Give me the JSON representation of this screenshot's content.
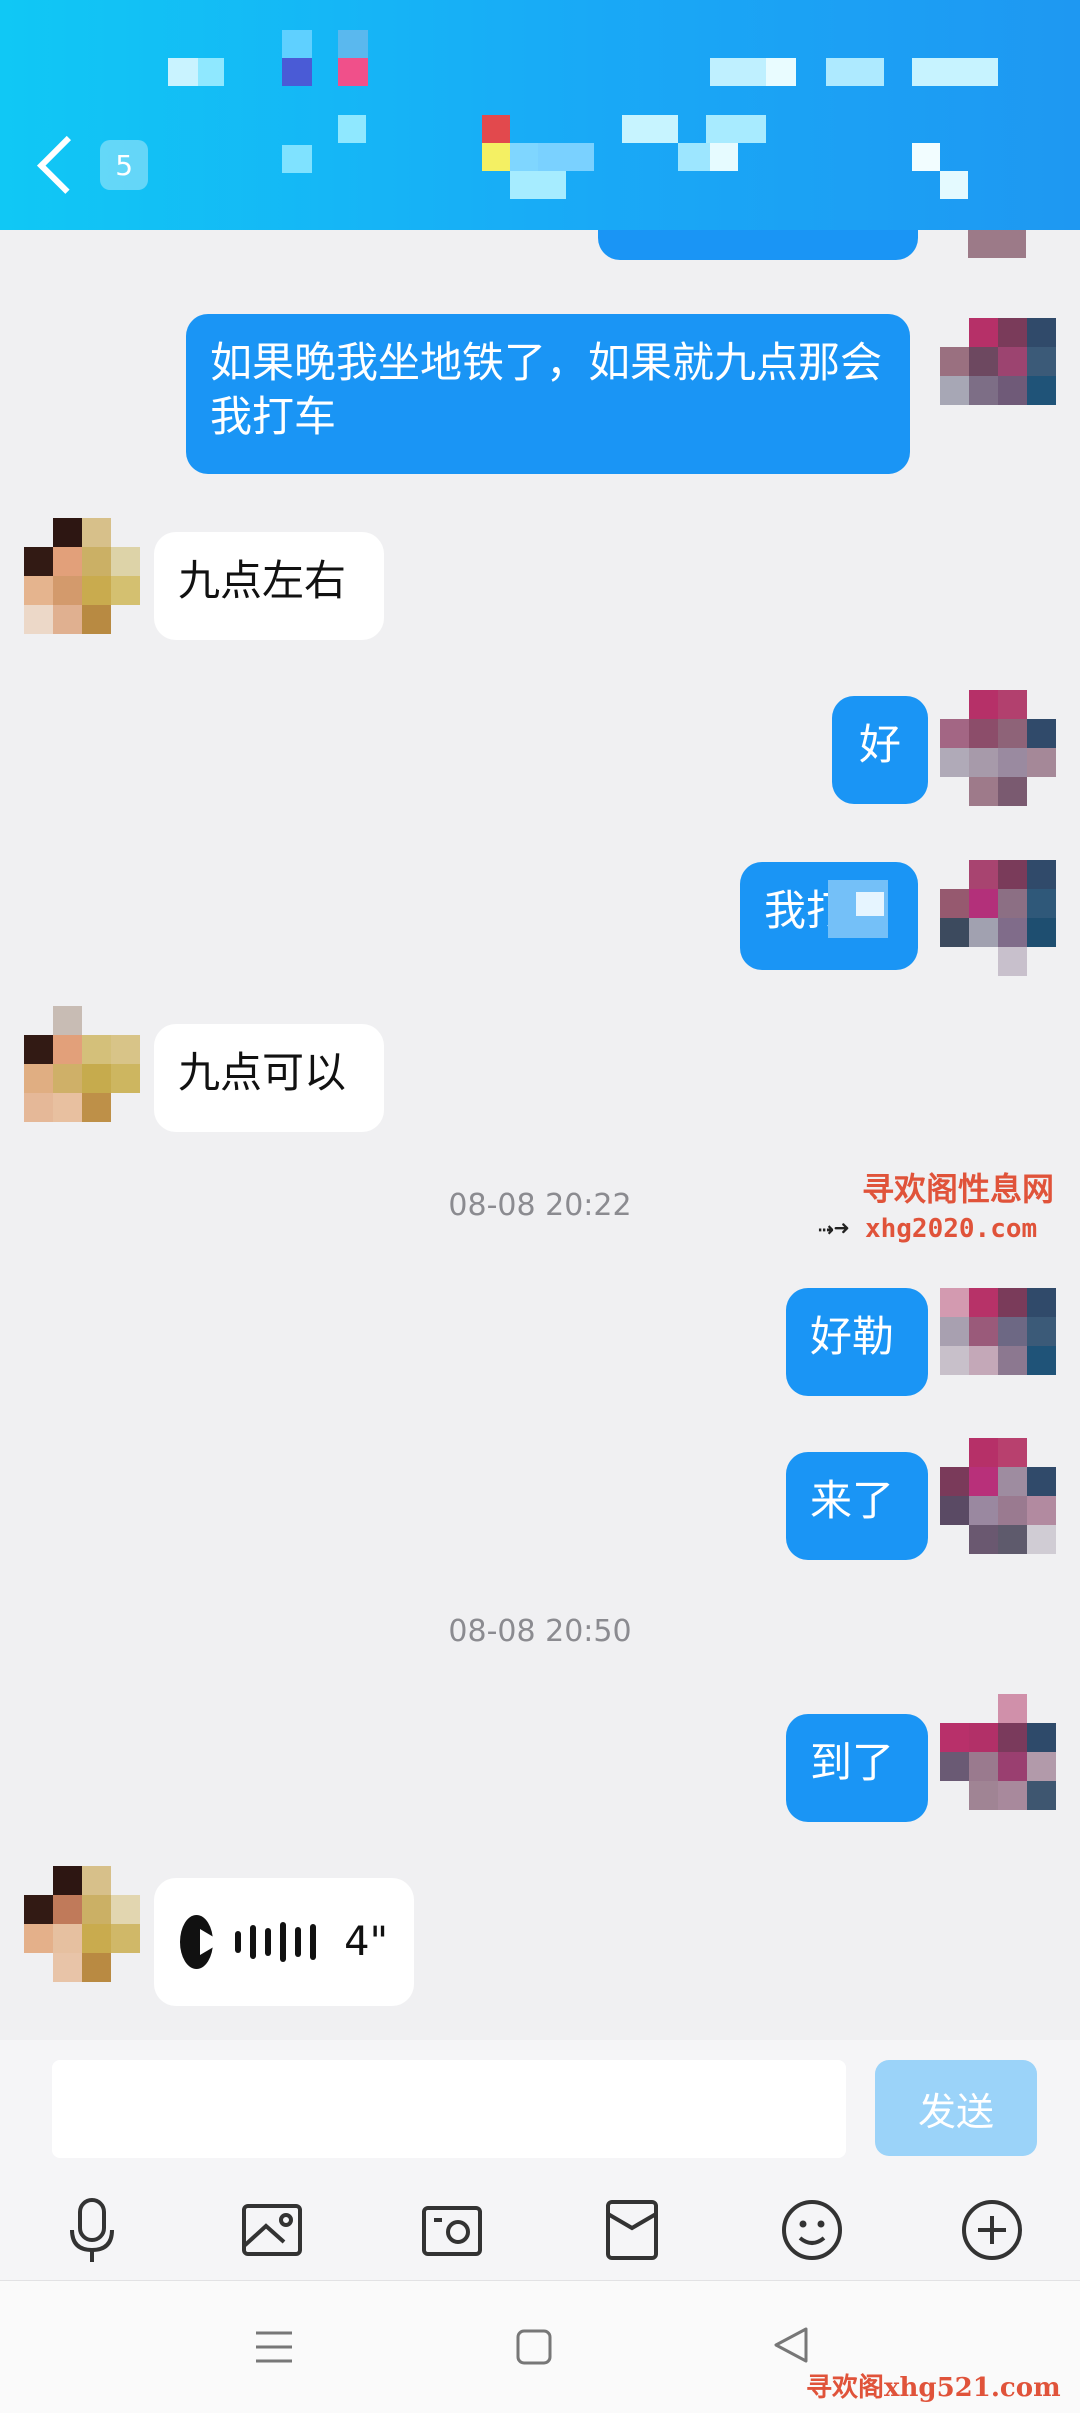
{
  "header": {
    "unread_count": "5",
    "accent_color": "#1a9df6"
  },
  "messages": [
    {
      "from": "me",
      "text": "如果晚我坐地铁了，如果就九点那会我打车"
    },
    {
      "from": "them",
      "text": "九点左右"
    },
    {
      "from": "me",
      "text": "好"
    },
    {
      "from": "me",
      "text": "我打"
    },
    {
      "from": "them",
      "text": "九点可以"
    },
    {
      "type": "time",
      "text": "08-08 20:22"
    },
    {
      "from": "me",
      "text": "好勒"
    },
    {
      "from": "me",
      "text": "来了"
    },
    {
      "type": "time",
      "text": "08-08 20:50"
    },
    {
      "from": "me",
      "text": "到了"
    },
    {
      "from": "them",
      "type": "voice",
      "duration": "4\""
    }
  ],
  "input": {
    "value": "",
    "send_label": "发送"
  },
  "toolbar": {
    "icons": [
      "microphone-icon",
      "image-icon",
      "camera-icon",
      "red-packet-icon",
      "emoji-icon",
      "plus-icon"
    ]
  },
  "watermark": {
    "line1": "寻欢阁性息网",
    "line2": "xhg2020.com",
    "bottom": "寻欢阁xhg521.com"
  }
}
